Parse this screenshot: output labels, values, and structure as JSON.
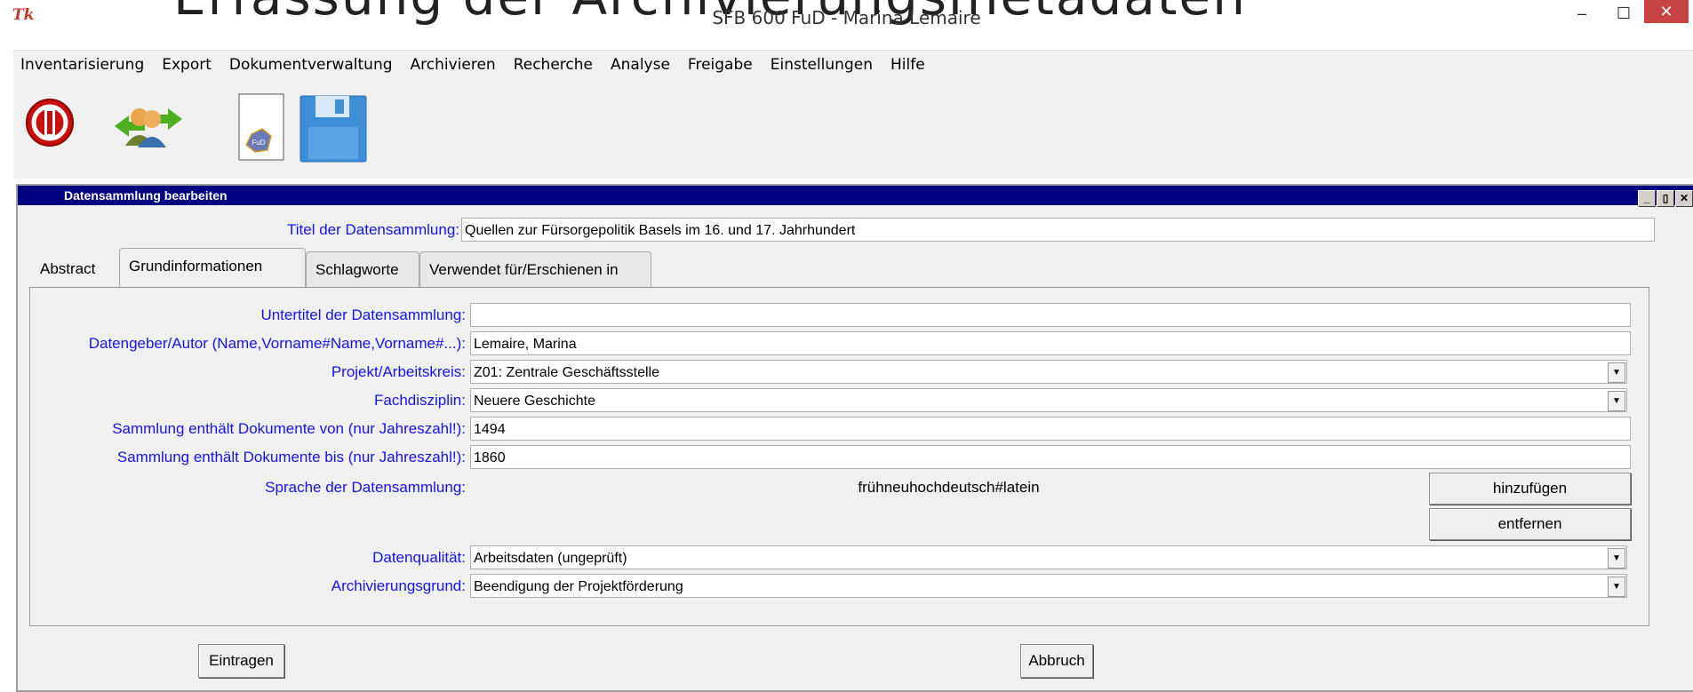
{
  "window": {
    "background_text": "Erfassung der Archivierungsmetadaten",
    "app_icon": "Tk",
    "title": "SFB 600 FuD - Marina Lemaire",
    "minimize": "–",
    "maximize": "☐",
    "close": "✕"
  },
  "menu": [
    "Inventarisierung",
    "Export",
    "Dokumentverwaltung",
    "Archivieren",
    "Recherche",
    "Analyse",
    "Freigabe",
    "Einstellungen",
    "Hilfe"
  ],
  "toolbar": {
    "icons": [
      "power-icon",
      "user-exchange-icon",
      "fud-document-icon",
      "save-disk-icon"
    ],
    "fud_badge": "FuD"
  },
  "frame": {
    "title": "Datensammlung bearbeiten",
    "buttons": [
      "_",
      "▯",
      "✕"
    ]
  },
  "form": {
    "title_label": "Titel der Datensammlung:",
    "title_value": "Quellen zur Fürsorgepolitik Basels im 16. und 17. Jahrhundert",
    "tabs": [
      "Abstract",
      "Grundinformationen",
      "Schlagworte",
      "Verwendet für/Erschienen in"
    ],
    "active_tab": "Grundinformationen",
    "fields": {
      "untertitel_label": "Untertitel der Datensammlung:",
      "untertitel_value": "",
      "autor_label": "Datengeber/Autor (Name,Vorname#Name,Vorname#...):",
      "autor_value": "Lemaire, Marina",
      "projekt_label": "Projekt/Arbeitskreis:",
      "projekt_value": "Z01: Zentrale Geschäftsstelle",
      "fach_label": "Fachdisziplin:",
      "fach_value": "Neuere Geschichte",
      "von_label": "Sammlung enthält Dokumente von (nur Jahreszahl!):",
      "von_value": "1494",
      "bis_label": "Sammlung enthält Dokumente bis (nur Jahreszahl!):",
      "bis_value": "1860",
      "sprache_label": "Sprache der Datensammlung:",
      "sprache_value": "frühneuhochdeutsch#latein",
      "qualitaet_label": "Datenqualität:",
      "qualitaet_value": "Arbeitsdaten (ungeprüft)",
      "grund_label": "Archivierungsgrund:",
      "grund_value": "Beendigung der Projektförderung"
    },
    "add_button": "hinzufügen",
    "remove_button": "entfernen",
    "submit_button": "Eintragen",
    "cancel_button": "Abbruch"
  }
}
